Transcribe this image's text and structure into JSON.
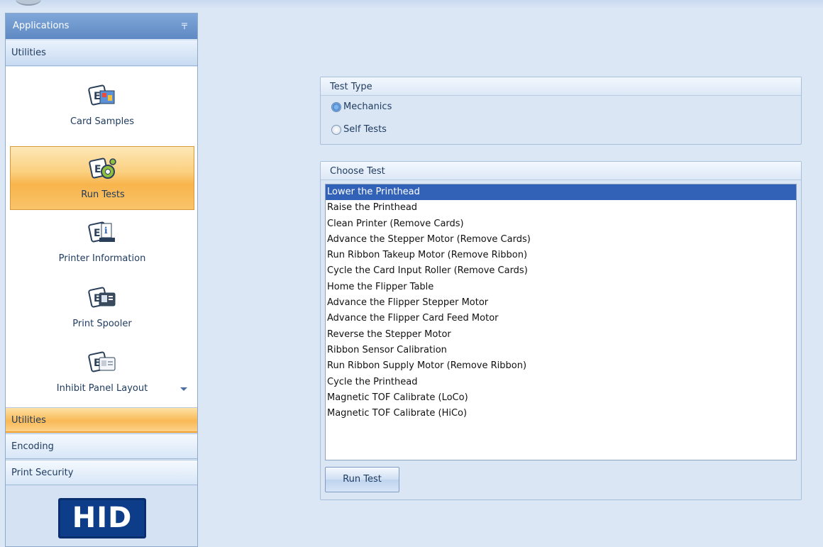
{
  "sidebar": {
    "header": "Applications",
    "pin_glyph": "〒",
    "section_title": "Utilities",
    "tools": [
      {
        "label": "Card Samples",
        "icon": "card-samples-icon",
        "active": false
      },
      {
        "label": "Run Tests",
        "icon": "run-tests-icon",
        "active": true
      },
      {
        "label": "Printer Information",
        "icon": "printer-information-icon",
        "active": false
      },
      {
        "label": "Print Spooler",
        "icon": "print-spooler-icon",
        "active": false
      },
      {
        "label": "Inhibit Panel Layout",
        "icon": "inhibit-panel-layout-icon",
        "active": false
      }
    ],
    "nav": [
      {
        "label": "Utilities",
        "active": true
      },
      {
        "label": "Encoding",
        "active": false
      },
      {
        "label": "Print Security",
        "active": false
      }
    ],
    "logo_text": "HID"
  },
  "test_type": {
    "title": "Test Type",
    "options": [
      {
        "label": "Mechanics",
        "checked": true
      },
      {
        "label": "Self Tests",
        "checked": false
      }
    ]
  },
  "choose_test": {
    "title": "Choose Test",
    "items": [
      "Lower the Printhead",
      "Raise the Printhead",
      "Clean Printer (Remove Cards)",
      "Advance the Stepper Motor (Remove Cards)",
      "Run Ribbon Takeup Motor (Remove Ribbon)",
      "Cycle the Card Input Roller (Remove Cards)",
      "Home the Flipper Table",
      "Advance the Flipper Stepper Motor",
      "Advance the Flipper Card Feed Motor",
      "Reverse the Stepper Motor",
      "Ribbon Sensor Calibration",
      "Run Ribbon Supply Motor (Remove Ribbon)",
      "Cycle the Printhead",
      "Magnetic TOF Calibrate (LoCo)",
      "Magnetic TOF Calibrate (HiCo)"
    ],
    "selected_index": 0,
    "run_button": "Run Test"
  },
  "colors": {
    "accent_blue": "#3162b8",
    "active_orange": "#f8b44c",
    "logo_blue": "#0d3c88"
  }
}
